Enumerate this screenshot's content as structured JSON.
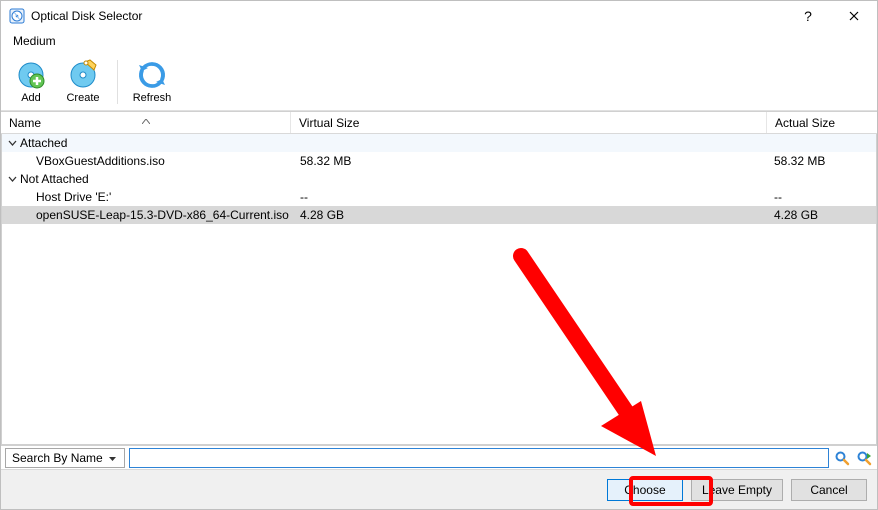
{
  "titlebar": {
    "title": "Optical Disk Selector"
  },
  "menubar": {
    "medium": "Medium"
  },
  "toolbar": {
    "add": "Add",
    "create": "Create",
    "refresh": "Refresh"
  },
  "columns": {
    "name": "Name",
    "virtual_size": "Virtual Size",
    "actual_size": "Actual Size"
  },
  "groups": [
    {
      "label": "Attached",
      "rows": [
        {
          "name": "VBoxGuestAdditions.iso",
          "vsize": "58.32 MB",
          "asize": "58.32 MB"
        }
      ]
    },
    {
      "label": "Not Attached",
      "rows": [
        {
          "name": "Host Drive 'E:'",
          "vsize": "--",
          "asize": "--"
        },
        {
          "name": "openSUSE-Leap-15.3-DVD-x86_64-Current.iso",
          "vsize": "4.28 GB",
          "asize": "4.28 GB"
        }
      ]
    }
  ],
  "search": {
    "mode_label": "Search By Name",
    "value": ""
  },
  "footer": {
    "choose": "Choose",
    "leave_empty": "Leave Empty",
    "cancel": "Cancel"
  }
}
